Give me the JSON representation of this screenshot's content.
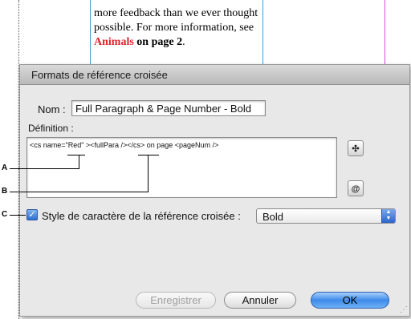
{
  "background_doc": {
    "line1": "more feedback than we ever thought",
    "line2": "possible. For more information, see",
    "link_red": "Animals",
    "link_bold": " on page 2",
    "period": "."
  },
  "dialog": {
    "title": "Formats de référence croisée",
    "nom_label": "Nom :",
    "nom_value": "Full Paragraph & Page Number - Bold",
    "definition_label": "Définition :",
    "definition_text": "<cs name=\"Red\" ><fullPara /></cs> on page <pageNum />",
    "side_buttons": [
      "insert-text-icon",
      "insert-special-character-icon"
    ],
    "charstyle_checkbox": {
      "checked": true,
      "label": "Style de caractère de la référence croisée :"
    },
    "charstyle_select": {
      "value": "Bold"
    },
    "buttons": {
      "save": "Enregistrer",
      "cancel": "Annuler",
      "ok": "OK"
    }
  },
  "callouts": [
    "A",
    "B",
    "C"
  ],
  "colors": {
    "link_red": "#e0242b",
    "accent_blue": "#3d8ae8"
  }
}
